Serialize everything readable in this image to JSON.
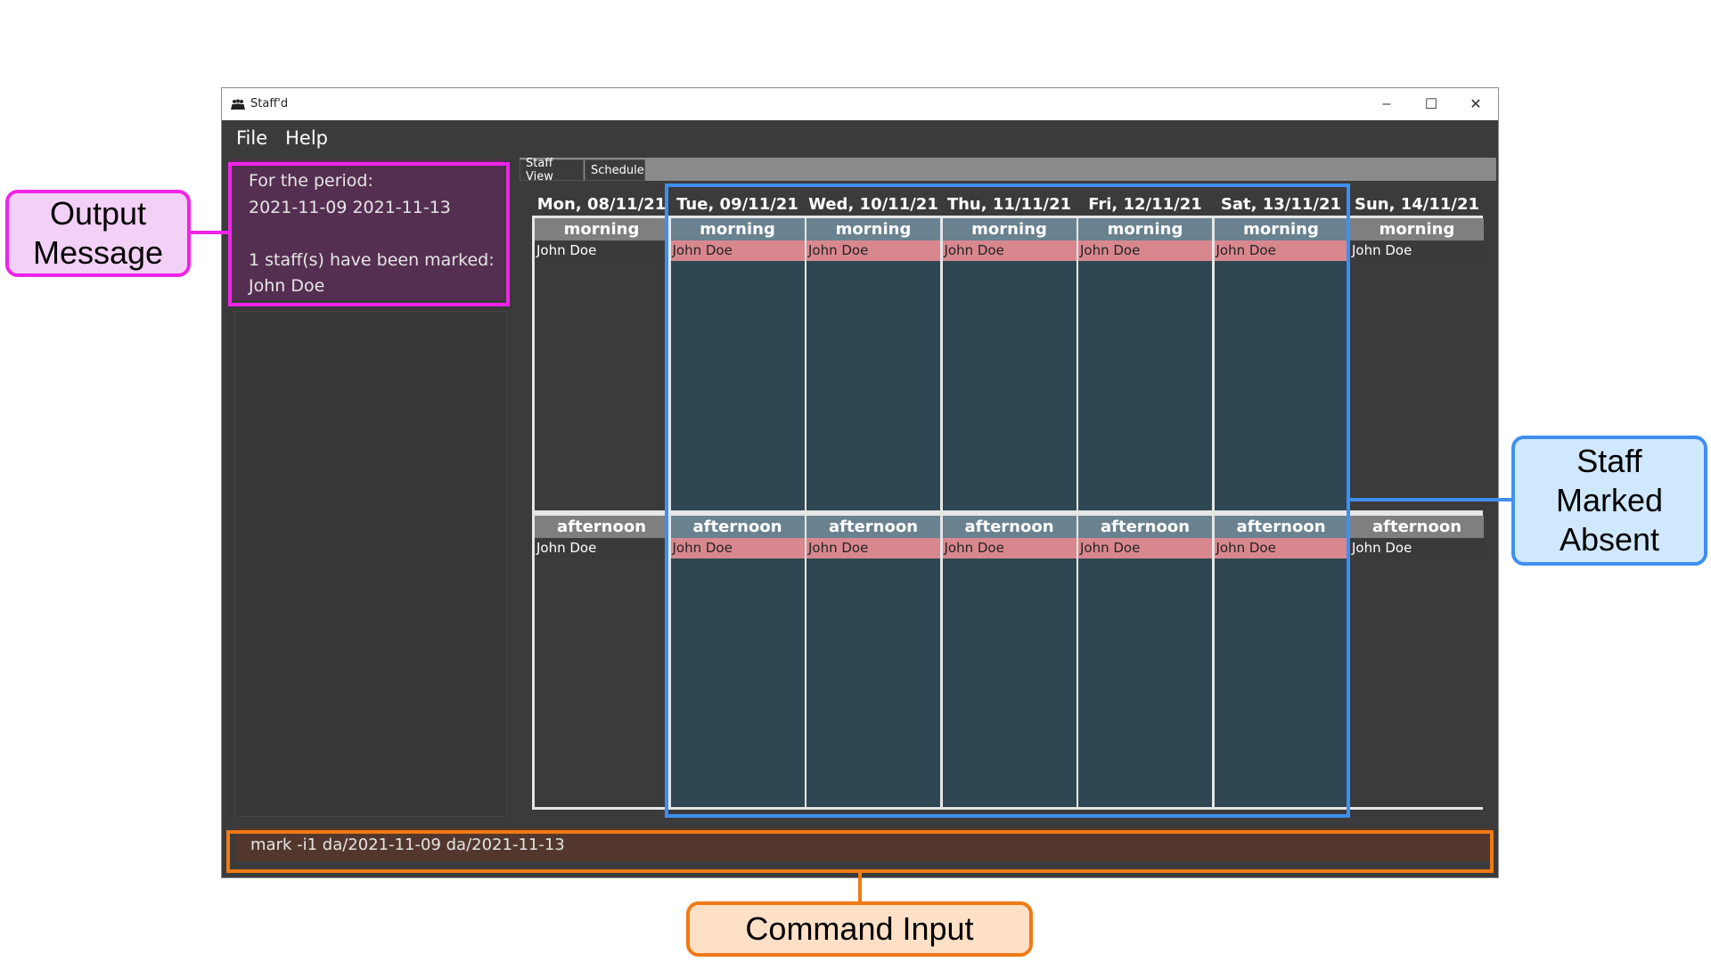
{
  "window": {
    "title": "Staff'd",
    "controls": {
      "minimize": "–",
      "maximize": "☐",
      "close": "✕"
    }
  },
  "menu": {
    "items": [
      "File",
      "Help"
    ]
  },
  "result_display": {
    "text": "For the period:\n2021-11-09 2021-11-13\n\n1 staff(s) have been marked:\nJohn Doe"
  },
  "tabs": [
    "Staff View",
    "Schedule"
  ],
  "schedule": {
    "days": [
      {
        "header": "Mon, 08/11/21",
        "marked": false,
        "morning": {
          "label": "morning",
          "staff": [
            "John Doe"
          ]
        },
        "afternoon": {
          "label": "afternoon",
          "staff": [
            "John Doe"
          ]
        }
      },
      {
        "header": "Tue, 09/11/21",
        "marked": true,
        "morning": {
          "label": "morning",
          "staff": [
            "John Doe"
          ]
        },
        "afternoon": {
          "label": "afternoon",
          "staff": [
            "John Doe"
          ]
        }
      },
      {
        "header": "Wed, 10/11/21",
        "marked": true,
        "morning": {
          "label": "morning",
          "staff": [
            "John Doe"
          ]
        },
        "afternoon": {
          "label": "afternoon",
          "staff": [
            "John Doe"
          ]
        }
      },
      {
        "header": "Thu, 11/11/21",
        "marked": true,
        "morning": {
          "label": "morning",
          "staff": [
            "John Doe"
          ]
        },
        "afternoon": {
          "label": "afternoon",
          "staff": [
            "John Doe"
          ]
        }
      },
      {
        "header": "Fri, 12/11/21",
        "marked": true,
        "morning": {
          "label": "morning",
          "staff": [
            "John Doe"
          ]
        },
        "afternoon": {
          "label": "afternoon",
          "staff": [
            "John Doe"
          ]
        }
      },
      {
        "header": "Sat, 13/11/21",
        "marked": true,
        "morning": {
          "label": "morning",
          "staff": [
            "John Doe"
          ]
        },
        "afternoon": {
          "label": "afternoon",
          "staff": [
            "John Doe"
          ]
        }
      },
      {
        "header": "Sun, 14/11/21",
        "marked": false,
        "morning": {
          "label": "morning",
          "staff": [
            "John Doe"
          ]
        },
        "afternoon": {
          "label": "afternoon",
          "staff": [
            "John Doe"
          ]
        }
      }
    ]
  },
  "command": {
    "value": "mark -i1 da/2021-11-09 da/2021-11-13"
  },
  "annotations": {
    "output": "Output\nMessage",
    "staff": "Staff\nMarked\nAbsent",
    "command": "Command Input"
  },
  "colors": {
    "output_accent": "#f024e8",
    "staff_accent": "#3f8ff0",
    "command_accent": "#f07a15",
    "marked_entry": "#d9878f",
    "result_bg": "#552f52",
    "command_bg": "#53372e"
  }
}
